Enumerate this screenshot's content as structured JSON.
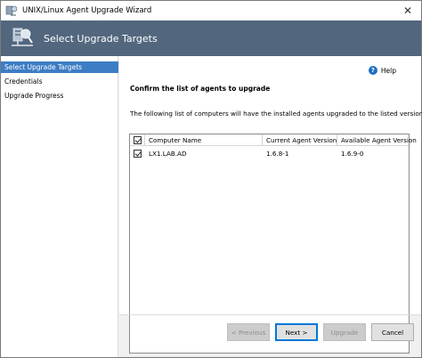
{
  "window": {
    "title": "UNIX/Linux Agent Upgrade Wizard",
    "close_glyph": "✕"
  },
  "banner": {
    "title": "Select Upgrade Targets"
  },
  "nav": {
    "items": [
      {
        "label": "Select Upgrade Targets",
        "selected": true
      },
      {
        "label": "Credentials",
        "selected": false
      },
      {
        "label": "Upgrade Progress",
        "selected": false
      }
    ]
  },
  "main": {
    "help_label": "Help",
    "heading": "Confirm the list of agents to upgrade",
    "description": "The following list of computers will have the installed agents upgraded to the listed versions.",
    "grid": {
      "columns": [
        "Computer Name",
        "Current Agent Version",
        "Available Agent Version"
      ],
      "header_checked": true,
      "rows": [
        {
          "checked": true,
          "name": "LX1.LAB.AD",
          "current": "1.6.8-1",
          "available": "1.6.9-0"
        }
      ]
    }
  },
  "buttons": {
    "previous": "< Previous",
    "next": "Next >",
    "upgrade": "Upgrade",
    "cancel": "Cancel"
  },
  "colors": {
    "banner": "#52677e",
    "nav_selected": "#3c7dc4",
    "help_icon": "#1e6fc0"
  }
}
